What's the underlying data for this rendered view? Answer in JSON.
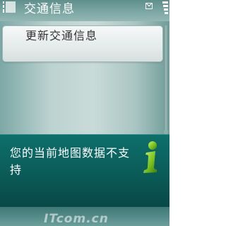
{
  "header": {
    "title": "交通信息",
    "signal_icon": "signal-strength-icon",
    "message_icon": "envelope-icon",
    "battery_icon": "battery-icon"
  },
  "menu": {
    "items": [
      {
        "label": "更新交通信息"
      }
    ]
  },
  "dialog": {
    "message": "您的当前地图数据不支持",
    "icon": "info-icon",
    "icon_color": "#7bc21e"
  },
  "watermark": {
    "text": "ITcom.cn"
  },
  "colors": {
    "dialog_background": "#0b5f5c",
    "header_background": "#7ea9a6"
  }
}
